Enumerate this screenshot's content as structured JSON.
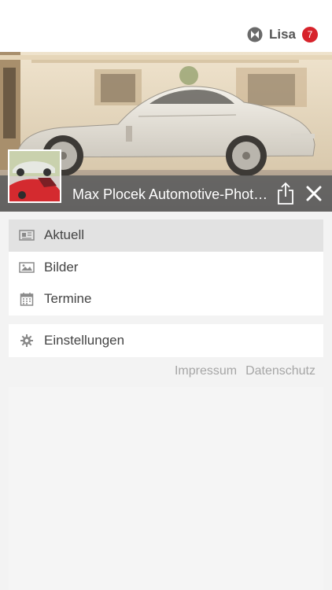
{
  "header": {
    "user_name": "Lisa",
    "notification_count": "7"
  },
  "hero": {
    "title": "Max Plocek Automotive-Photo..."
  },
  "menu": {
    "items": [
      {
        "label": "Aktuell",
        "icon": "newspaper-icon",
        "active": true
      },
      {
        "label": "Bilder",
        "icon": "image-icon",
        "active": false
      },
      {
        "label": "Termine",
        "icon": "calendar-icon",
        "active": false
      }
    ],
    "settings": {
      "label": "Einstellungen",
      "icon": "gear-icon"
    }
  },
  "footer": {
    "impressum": "Impressum",
    "datenschutz": "Datenschutz"
  },
  "colors": {
    "badge": "#d7232b",
    "hero_bar": "#5f5f5f",
    "active_item": "#e2e2e2"
  }
}
